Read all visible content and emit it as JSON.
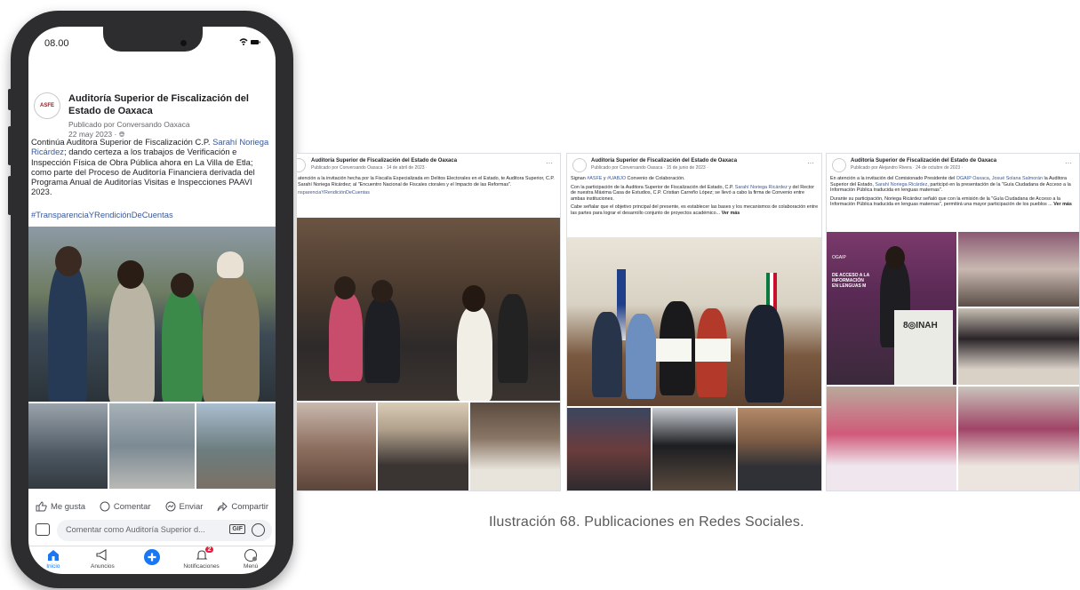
{
  "phone": {
    "status_time": "08.00",
    "post": {
      "avatar_text": "ASFE",
      "page_name": "Auditoría Superior de Fiscalización del Estado de Oaxaca",
      "published_by": "Publicado por Conversando Oaxaca",
      "date": "22 may 2023 · ",
      "text_before": "Continúa Auditora Superior de Fiscalización C.P. ",
      "mention": "Sarahí Noriega Ricárdez",
      "text_after": "; dando certeza a los trabajos de Verificación e Inspección Física de Obra Pública ahora en La Villa de Etla; como parte del Proceso de Auditoría Financiera derivada del Programa Anual de Auditorías Visitas e Inspecciones PAAVI 2023.",
      "hashtag": "#TransparenciaYRendiciónDeCuentas"
    },
    "actions": {
      "like": "Me gusta",
      "comment": "Comentar",
      "send": "Enviar",
      "share": "Compartir"
    },
    "comment_placeholder": "Comentar como Auditoría Superior d...",
    "gif_label": "GIF",
    "tabs": [
      {
        "label": "Inicio"
      },
      {
        "label": "Anuncios"
      },
      {
        "label": ""
      },
      {
        "label": "Notificaciones",
        "badge": "2"
      },
      {
        "label": "Menú"
      }
    ]
  },
  "cards": [
    {
      "page_name": "Auditoría Superior de Fiscalización del Estado de Oaxaca",
      "meta": "Publicado por Conversando Oaxaca · 14 de abril de 2023 ·",
      "text": "atención a la invitación hecha por la Fiscalía Especializada en Delitos Electorales en el Estado, te Auditora Superior, C.P. Sarahí Noriega Ricárdez; al \"Encuentro Nacional de Fiscales ctorales y el Impacto de las Reformas\".",
      "hashtag": "nsparenciaYRendiciónDeCuentas"
    },
    {
      "page_name": "Auditoría Superior de Fiscalización del Estado de Oaxaca",
      "meta": "Publicado por Conversando Oaxaca · 15 de junio de 2023 ·",
      "p1_a": "Signan ",
      "p1_m1": "#ASFE",
      "p1_b": " y ",
      "p1_m2": "#UABJO",
      "p1_c": " Convenio de Colaboración.",
      "p2_a": "Con la participación de la Auditora Superior de Fiscalización del Estado, C.P. ",
      "p2_m": "Sarahí Noriega Ricárdez",
      "p2_b": " y del Rector de nuestra Máxima Casa de Estudios, C.P. Cristian Carreño López; se llevó a cabo la firma de Convenio entre ambas instituciones.",
      "p3": "Cabe señalar que el objetivo principal del presente, es establecer las bases y los mecanismos de colaboración entre las partes para lograr el desarrollo conjunto de proyectos académico...",
      "more": "Ver más"
    },
    {
      "page_name": "Auditoría Superior de Fiscalización del Estado de Oaxaca",
      "meta": "Publicado por Alejandro Rivera · 24 de octubre de 2023 ·",
      "p1_a": "En atención a la invitación del Comisionado Presidente del ",
      "p1_m1": "OGAIP Oaxaca",
      "p1_b": ", ",
      "p1_m2": "Josué Solana Salmorán",
      "p1_c": " la Auditora Superior del Estado, ",
      "p1_m3": "Sarahí Noriega Ricárdez",
      "p1_d": ", participó en la presentación de la \"Guía Ciudadana de Acceso a la Información Pública traducida en lenguas maternas\".",
      "p2": "Durante su participación, Noriega Ricárdez señaló que con la emisión de la \"Guía Ciudadana de Acceso a la Información Pública traducida en lenguas maternas\", permitirá una mayor participación de los pueblos ...",
      "more": "Ver más",
      "banner_logo": "OGAIP",
      "banner_text": "DE ACCESO A LA INFORMACIÓN EN LENGUAS M",
      "inah": "8◎INAH"
    }
  ],
  "caption": "Ilustración 68. Publicaciones en Redes Sociales."
}
